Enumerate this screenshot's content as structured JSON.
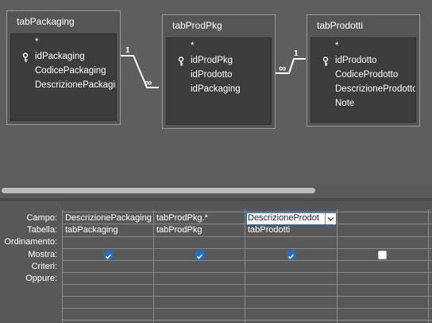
{
  "tables": [
    {
      "title": "tabPackaging",
      "fields": [
        {
          "name": "*",
          "key": false
        },
        {
          "name": "idPackaging",
          "key": true
        },
        {
          "name": "CodicePackaging",
          "key": false
        },
        {
          "name": "DescrizionePackaging",
          "key": false
        }
      ]
    },
    {
      "title": "tabProdPkg",
      "fields": [
        {
          "name": "*",
          "key": false
        },
        {
          "name": "idProdPkg",
          "key": true
        },
        {
          "name": "idProdotto",
          "key": false
        },
        {
          "name": "idPackaging",
          "key": false
        }
      ]
    },
    {
      "title": "tabProdotti",
      "fields": [
        {
          "name": "*",
          "key": false
        },
        {
          "name": "idProdotto",
          "key": true
        },
        {
          "name": "CodiceProdotto",
          "key": false
        },
        {
          "name": "DescrizioneProdotto",
          "key": false
        },
        {
          "name": "Note",
          "key": false
        }
      ]
    }
  ],
  "relations": [
    {
      "one": "1",
      "many": "∞"
    },
    {
      "one": "1",
      "many": "∞"
    }
  ],
  "grid": {
    "row_labels": [
      "Campo:",
      "Tabella:",
      "Ordinamento:",
      "Mostra:",
      "Criteri:",
      "Oppure:"
    ],
    "columns": [
      {
        "campo": "DescrizionePackaging",
        "tabella": "tabPackaging",
        "mostra": true
      },
      {
        "campo": "tabProdPkg.*",
        "tabella": "tabProdPkg",
        "mostra": true
      },
      {
        "campo": "DescrizioneProdot",
        "tabella": "tabProdotti",
        "mostra": true
      },
      {
        "campo": "",
        "tabella": "",
        "mostra": false
      }
    ]
  },
  "colors": {
    "background": "#5e5e5e",
    "accent": "#1f6fc5"
  }
}
